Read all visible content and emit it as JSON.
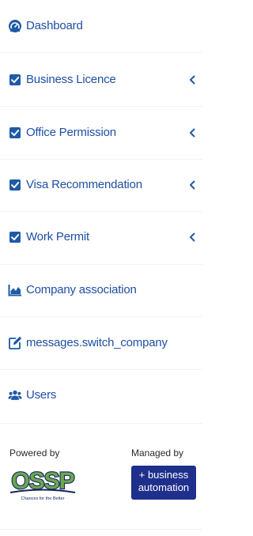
{
  "menu": {
    "items": [
      {
        "label": "Dashboard",
        "icon": "dashboard-icon",
        "has_submenu": false
      },
      {
        "label": "Business Licence",
        "icon": "checkbox-icon",
        "has_submenu": true
      },
      {
        "label": "Office Permission",
        "icon": "checkbox-icon",
        "has_submenu": true
      },
      {
        "label": "Visa Recommendation",
        "icon": "checkbox-icon",
        "has_submenu": true
      },
      {
        "label": "Work Permit",
        "icon": "checkbox-icon",
        "has_submenu": true
      },
      {
        "label": "Company association",
        "icon": "area-chart-icon",
        "has_submenu": false
      },
      {
        "label": "messages.switch_company",
        "icon": "edit-icon",
        "has_submenu": false
      },
      {
        "label": "Users",
        "icon": "users-icon",
        "has_submenu": false
      }
    ]
  },
  "footer": {
    "powered_by_label": "Powered by",
    "managed_by_label": "Managed by",
    "ossp_logo_text": "OSSP",
    "ossp_tagline": "Chances for the Better",
    "ba_logo_line1": "+ business",
    "ba_logo_line2": "automation"
  },
  "colors": {
    "link": "#1f4fa3",
    "icon": "#1f5aa6",
    "ossp_navy": "#16245e",
    "ossp_green": "#6aa84f",
    "ba_bg": "#1e2f8c"
  }
}
